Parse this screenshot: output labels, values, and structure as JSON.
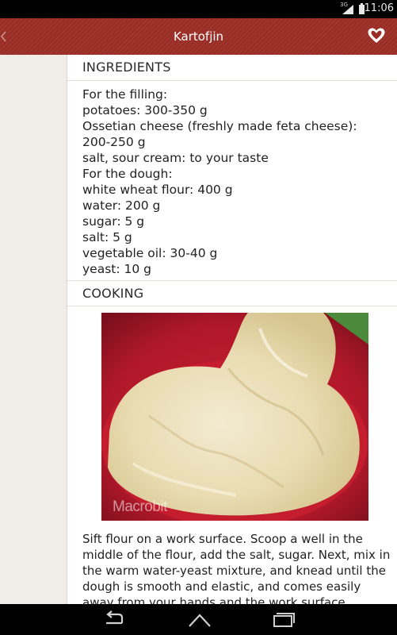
{
  "status_bar": {
    "signal_label": "3G",
    "time": "11:06"
  },
  "action_bar": {
    "title": "Kartofjin",
    "icons": {
      "back": "chevron-left-icon",
      "favorite": "heart-icon"
    }
  },
  "recipe": {
    "ingredients_heading": "INGREDIENTS",
    "ingredients": [
      "For the filling:",
      "potatoes: 300-350 g",
      "Ossetian cheese (freshly made feta cheese):",
      "200-250 g",
      "salt, sour cream: to your taste",
      "For the dough:",
      "white wheat flour: 400 g",
      "water: 200 g",
      "sugar: 5 g",
      "salt: 5 g",
      "vegetable oil: 30-40 g",
      "yeast: 10 g"
    ],
    "cooking_heading": "COOKING",
    "photo_watermark": "Macrobit",
    "cooking_text": "Sift flour on a work surface.  Scoop a well in the middle of the flour, add the salt, sugar. Next, mix in the  warm water-yeast mixture, and knead until the dough is smooth and elastic, and comes easily away from your hands and the work surface."
  },
  "nav_bar": {
    "icons": [
      "back-icon",
      "home-icon",
      "recents-icon"
    ]
  }
}
